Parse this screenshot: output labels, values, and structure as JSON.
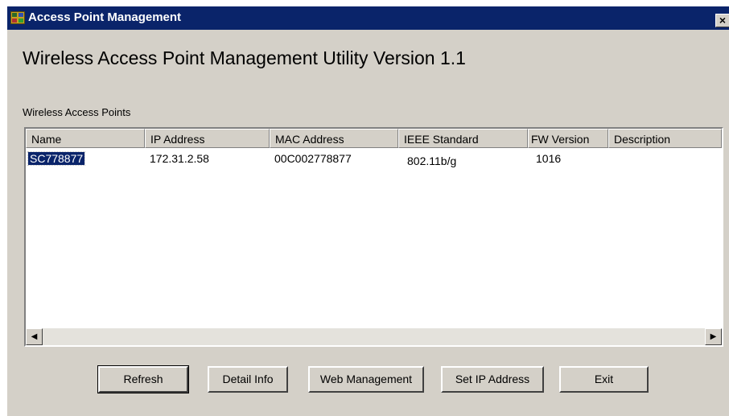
{
  "window": {
    "title": "Access Point Management",
    "close_glyph": "×"
  },
  "heading": "Wireless Access Point Management Utility Version 1.1",
  "list": {
    "label": "Wireless Access Points",
    "columns": [
      "Name",
      "IP Address",
      "MAC Address",
      "IEEE Standard",
      "FW Version",
      "Description"
    ],
    "rows": [
      {
        "name": "SC778877",
        "ip": "172.31.2.58",
        "mac": "00C002778877",
        "ieee": "802.11b/g",
        "fw": "1016",
        "description": "",
        "selected": true
      }
    ],
    "scroll_left_glyph": "◀",
    "scroll_right_glyph": "▶"
  },
  "buttons": {
    "refresh": "Refresh",
    "detail_info": "Detail Info",
    "web_management": "Web Management",
    "set_ip": "Set IP Address",
    "exit": "Exit"
  },
  "colors": {
    "titlebar": "#0a246a",
    "selection": "#0a246a",
    "face": "#d4d0c8"
  }
}
